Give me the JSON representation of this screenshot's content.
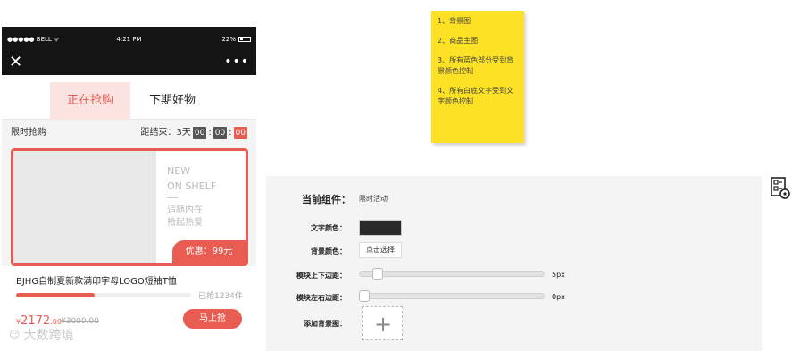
{
  "phone": {
    "status": {
      "carrier": "●●●●● BELL ᯤ",
      "time": "4:21 PM",
      "battery": "22%"
    },
    "nav": {
      "close": "✕",
      "more": "•••"
    },
    "tabs": [
      {
        "label": "正在抢购",
        "active": true
      },
      {
        "label": "下期好物",
        "active": false
      }
    ],
    "flash": {
      "label": "限时抢购",
      "countdown_prefix": "距结束：3天",
      "hours": "00",
      "sep1": ":",
      "minutes": "00",
      "sep2": ":",
      "seconds": "00"
    },
    "product": {
      "new_line1": "NEW",
      "new_line2": "ON SHELF",
      "tag_line1": "追随内在",
      "tag_line2": "拾起热爱",
      "promo": "优惠：99元",
      "name": "BJHG自制夏新款满印字母LOGO短袖T恤",
      "progress": 0.45,
      "sold": "已抢1234件",
      "currency": "¥",
      "price": "2172",
      "cents": ".00",
      "orig_price": "¥3000.00",
      "buy_label": "马上抢"
    }
  },
  "note": {
    "items": [
      "1、背景图",
      "2、商品主图",
      "3、所有蓝色部分受到背景颜色控制",
      "4、所有白底文字受到文字颜色控制"
    ]
  },
  "panel": {
    "title": "当前组件：",
    "component": "限时活动",
    "text_color_label": "文字颜色：",
    "text_color": "#2a2a2a",
    "bg_color_label": "背景颜色：",
    "pick_button": "点击选择",
    "margin_v_label": "模块上下边距：",
    "margin_v_value": "5px",
    "margin_h_label": "模块左右边距：",
    "margin_h_value": "0px",
    "bg_image_label": "添加背景图：",
    "add_icon": "+"
  },
  "side_icon": "document-settings-icon",
  "watermark": "大数跨境",
  "colors": {
    "accent": "#e95c52",
    "note": "#fde124",
    "dark_bar": "#141414"
  }
}
